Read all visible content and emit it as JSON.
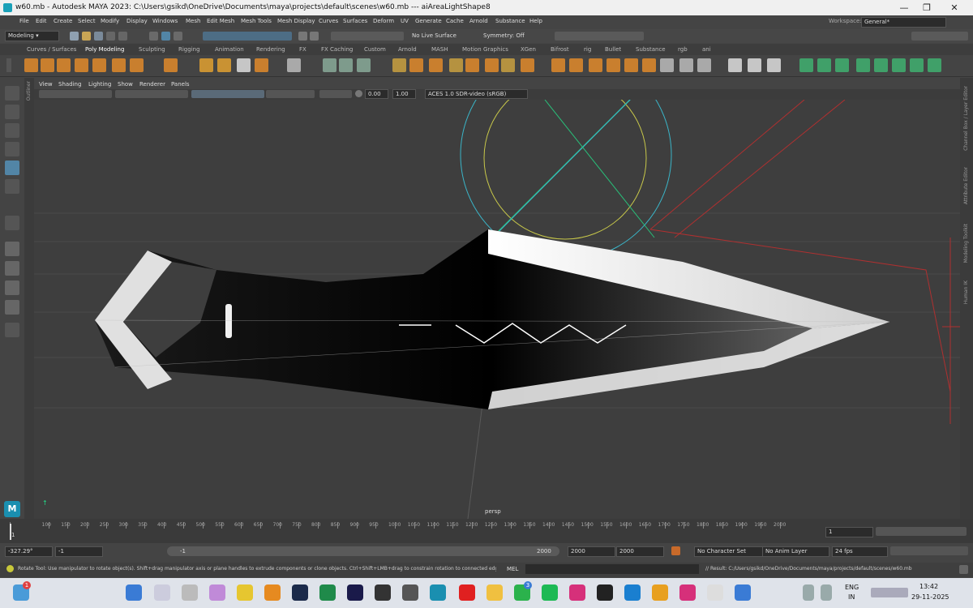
{
  "window": {
    "title": "w60.mb - Autodesk MAYA 2023: C:\\Users\\gsikd\\OneDrive\\Documents\\maya\\projects\\default\\scenes\\w60.mb   ---   aiAreaLightShape8"
  },
  "menus": [
    "File",
    "Edit",
    "Create",
    "Select",
    "Modify",
    "Display",
    "Windows",
    "Mesh",
    "Edit Mesh",
    "Mesh Tools",
    "Mesh Display",
    "Curves",
    "Surfaces",
    "Deform",
    "UV",
    "Generate",
    "Cache",
    "Arnold",
    "Substance",
    "Help"
  ],
  "workspace": {
    "label": "Workspace:",
    "value": "General*"
  },
  "statusline": {
    "mode": "Modeling",
    "live_surface": "No Live Surface",
    "symmetry": "Symmetry: Off"
  },
  "shelf_tabs": [
    "Curves / Surfaces",
    "Poly Modeling",
    "Sculpting",
    "Rigging",
    "Animation",
    "Rendering",
    "FX",
    "FX Caching",
    "Custom",
    "Arnold",
    "MASH",
    "Motion Graphics",
    "XGen",
    "Bifrost",
    "rig",
    "Bullet",
    "Substance",
    "rgb",
    "ani"
  ],
  "shelf_active": "Poly Modeling",
  "panel_menu": [
    "View",
    "Shading",
    "Lighting",
    "Show",
    "Renderer",
    "Panels"
  ],
  "panel_toolbar": {
    "exposure": "0.00",
    "gamma": "1.00",
    "color_space": "ACES 1.0 SDR-video (sRGB)"
  },
  "viewport": {
    "camera": "persp"
  },
  "side_labels": {
    "outliner": "Outliner",
    "right": [
      "Channel Box / Layer Editor",
      "Attribute Editor",
      "Modeling Toolkit",
      "Human IK"
    ]
  },
  "timeline": {
    "ticks": [
      "1",
      "100",
      "150",
      "200",
      "250",
      "300",
      "350",
      "400",
      "450",
      "500",
      "550",
      "600",
      "650",
      "700",
      "750",
      "800",
      "850",
      "900",
      "950",
      "1000",
      "1050",
      "1100",
      "1150",
      "1200",
      "1250",
      "1300",
      "1350",
      "1400",
      "1450",
      "1500",
      "1550",
      "1600",
      "1650",
      "1700",
      "1750",
      "1800",
      "1850",
      "1900",
      "1950",
      "2000"
    ],
    "current": "1",
    "frame_field": "1"
  },
  "range": {
    "angle": "-327.29°",
    "start": "-1",
    "range_start": "-1",
    "range_end": "2000",
    "end1": "2000",
    "end2": "2000",
    "char_set": "No Character Set",
    "anim_layer": "No Anim Layer",
    "fps": "24 fps"
  },
  "help": {
    "text": "Rotate Tool: Use manipulator to rotate object(s). Shift+drag manipulator axis or plane handles to extrude components or clone objects. Ctrl+Shift+LMB+drag to constrain rotation to connected edges. Use D or INSE",
    "mel": "MEL",
    "result": "// Result: C:/Users/gsikd/OneDrive/Documents/maya/projects/default/scenes/w60.mb"
  },
  "taskbar": {
    "lang": "ENG",
    "region": "IN",
    "time": "13:42",
    "date": "29-11-2025",
    "badge1": "1",
    "badge2": "3"
  },
  "colors": {
    "maya_bg": "#444444",
    "viewport_bg": "#3e3e3e",
    "accent": "#5285a6",
    "taskbar": "#dfe3ea"
  }
}
